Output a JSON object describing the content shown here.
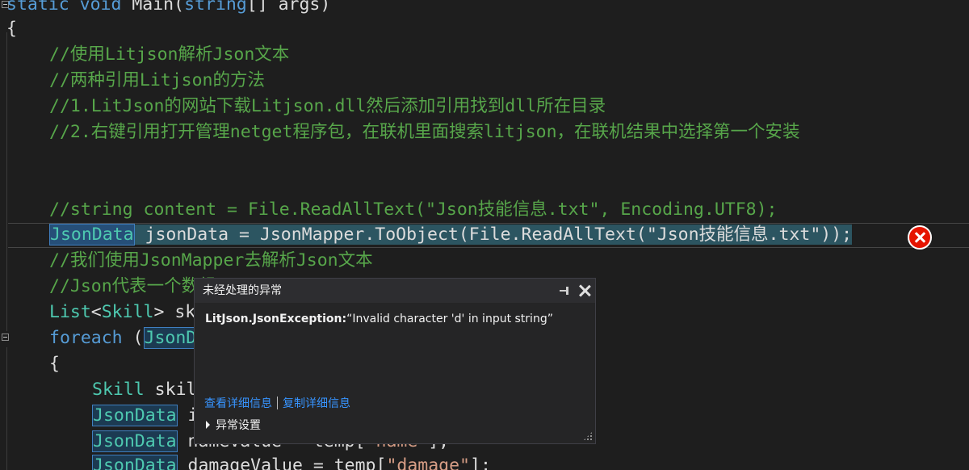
{
  "code": {
    "line_signature": {
      "kw1": "static",
      "kw2": "void",
      "rest1": " Main(",
      "kw3": "string",
      "rest2": "[] args)"
    },
    "open_brace": "{",
    "comment1": "//使用Litjson解析Json文本",
    "comment2": "//两种引用Litjson的方法",
    "comment3": "//1.LitJson的网站下载Litjson.dll然后添加引用找到dll所在目录",
    "comment4": "//2.右键引用打开管理netget程序包，在联机里面搜索litjson，在联机结果中选择第一个安装",
    "comment5": "//string content = File.ReadAllText(\"Json技能信息.txt\", Encoding.UTF8);",
    "current_line": {
      "type": "JsonData",
      "rest": " jsonData = JsonMapper.ToObject(File.ReadAllText(\"Json技能信息.txt\"));"
    },
    "comment6": "//我们使用JsonMapper去解析Json文本",
    "comment7_visible": "//Json代表一个",
    "comment7_tail": "数组",
    "list_line": {
      "type": "List",
      "lt": "<",
      "type2": "Skill",
      "rest": "> sk"
    },
    "foreach_line": {
      "kw": "foreach",
      "paren": " (",
      "type": "JsonD"
    },
    "brace_line": "{",
    "skill_line": {
      "type": "Skill",
      "rest": " skil"
    },
    "jd1": {
      "type": "JsonData",
      "rest": " i"
    },
    "jd2": {
      "type": "JsonData",
      "rest": " nameValue = temp[",
      "str": "\"name\"",
      "tail": "];"
    },
    "jd3": {
      "type": "JsonData",
      "rest": " damageValue = temp[",
      "str": "\"damage\"",
      "tail": "];"
    }
  },
  "exception_popup": {
    "title": "未经处理的异常",
    "exception_type": "LitJson.JsonException:",
    "exception_message": "“Invalid character 'd' in input string”",
    "view_details": "查看详细信息",
    "copy_details": "复制详细信息",
    "exception_settings": "异常设置"
  },
  "icons": {
    "error": "error-circle-icon",
    "pin": "pin-icon",
    "close": "close-icon",
    "collapse": "collapse-icon",
    "expand": "expand-triangle-icon",
    "resize": "resize-grip-icon"
  },
  "colors": {
    "background": "#1e1e1e",
    "comment": "#57a64a",
    "keyword": "#569cd6",
    "type": "#4ec9b0",
    "string": "#d69d85",
    "error": "#e51400",
    "link": "#3794ff"
  }
}
